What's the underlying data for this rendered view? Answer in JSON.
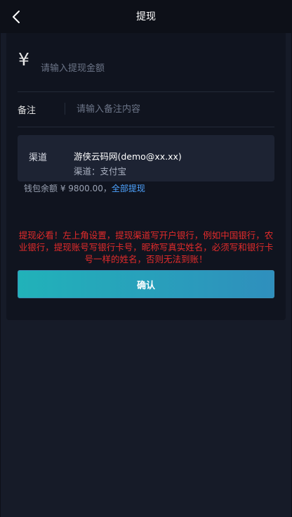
{
  "header": {
    "title": "提现"
  },
  "amount": {
    "currency_symbol": "¥",
    "placeholder": "请输入提现金额"
  },
  "remark": {
    "label": "备注",
    "placeholder": "请输入备注内容"
  },
  "channel": {
    "label": "渠道",
    "name": "游侠云码网(demo@xx.xx)",
    "method": "渠道：支付宝"
  },
  "balance": {
    "text": "钱包余额 ¥ 9800.00，",
    "withdraw_all": "全部提现"
  },
  "notice": "提现必看！左上角设置，提现渠道写开户银行，例如中国银行，农业银行，提现账号写银行卡号，昵称写真实姓名，必须写和银行卡号一样的姓名，否则无法到账！",
  "confirm_label": "确认",
  "colors": {
    "background": "#161b28",
    "header": "#0d1018",
    "card": "#10141f",
    "channel_box": "#1d2333",
    "notice": "#e42b2b",
    "link": "#4ea3ff",
    "button_start": "#21b2b9",
    "button_end": "#2f8fbd"
  },
  "icons": {
    "back": "chevron-left-icon"
  }
}
